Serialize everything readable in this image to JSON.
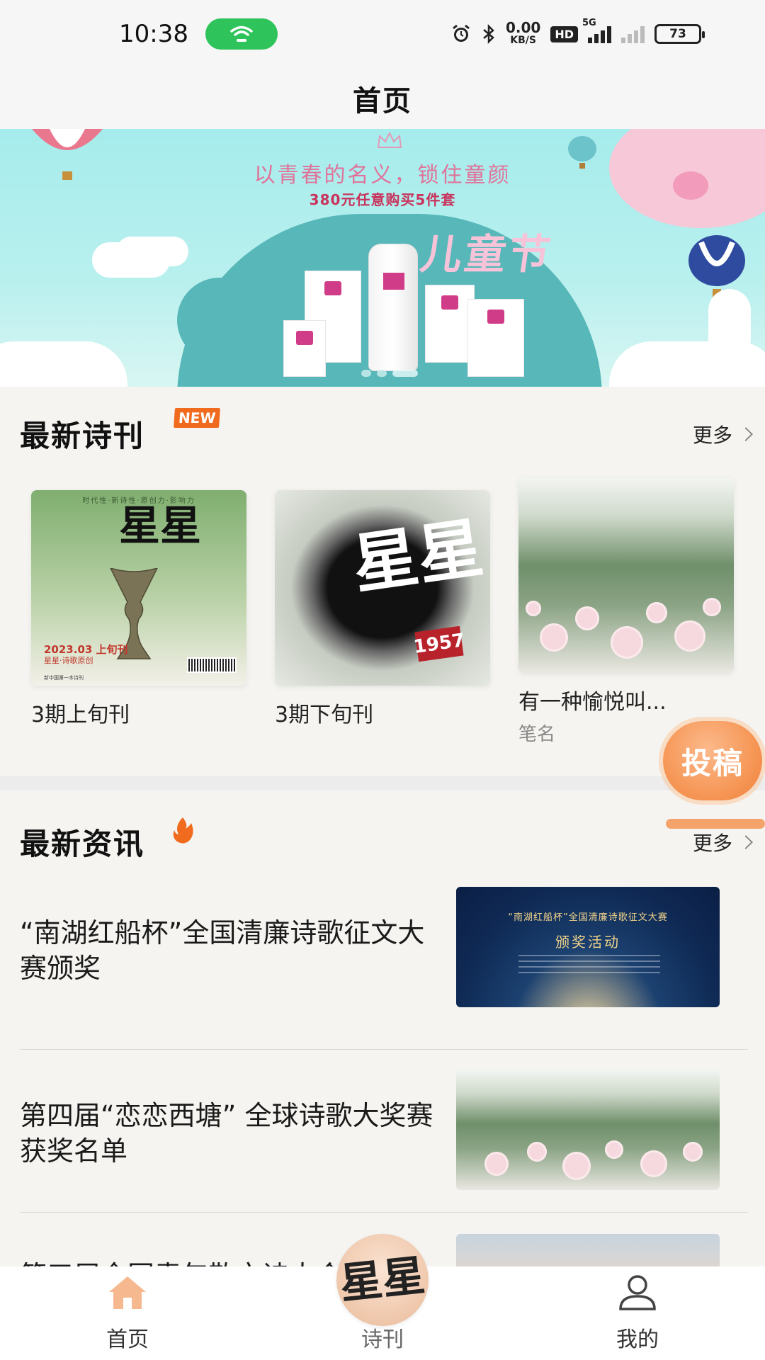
{
  "status_bar": {
    "time": "10:38",
    "net_speed_value": "0.00",
    "net_speed_unit": "KB/S",
    "hd_label": "HD",
    "signal_tag": "5G",
    "battery": "73",
    "icons": [
      "wifi-icon",
      "alarm-icon",
      "bluetooth-icon",
      "signal-icon",
      "signal-off-icon",
      "battery-icon"
    ],
    "wifi_pill_color": "#2fc45b"
  },
  "header": {
    "title": "首页"
  },
  "banner": {
    "line1": "以青春的名义，锁住童颜",
    "line2": "380元任意购买5件套",
    "festival": "儿童节",
    "slide_count": 3,
    "active_slide": 2
  },
  "journals": {
    "title": "最新诗刊",
    "badge": "NEW",
    "more_label": "更多",
    "items": [
      {
        "name": "3期上旬刊",
        "author": "",
        "cover": {
          "top": "时代性·新诗性·原创力·影响力",
          "calligraphy": "星星",
          "date": "2023.03 上旬刊",
          "subtitle": "星星·诗歌原创",
          "footer": "新中国第一本诗刊"
        }
      },
      {
        "name": "3期下旬刊",
        "author": "",
        "cover": {
          "calligraphy": "星星",
          "seal": "1957"
        }
      },
      {
        "name": "有一种愉悦叫...",
        "author": "笔名"
      }
    ]
  },
  "float_button": {
    "label": "投稿",
    "color": "#f69858"
  },
  "news": {
    "title": "最新资讯",
    "more_label": "更多",
    "items": [
      {
        "title": "“南湖红船杯”全国清廉诗歌征文大赛颁奖",
        "thumb_line1": "“南湖红船杯”全国清廉诗歌征文大赛",
        "thumb_line2": "颁奖活动"
      },
      {
        "title": "第四届“恋恋西塘” 全球诗歌大奖赛获奖名单"
      },
      {
        "title": "第三届全国青年散文诗大会"
      }
    ]
  },
  "tabbar": {
    "tabs": [
      {
        "label": "首页",
        "icon": "home-icon",
        "active_color": "#f5b88f"
      },
      {
        "label": "诗刊",
        "icon": "xingxing-logo-icon"
      },
      {
        "label": "我的",
        "icon": "user-icon"
      }
    ],
    "center_glyph": "星星"
  },
  "colors": {
    "accent_orange": "#f06b1e",
    "background": "#f5f4f0"
  }
}
